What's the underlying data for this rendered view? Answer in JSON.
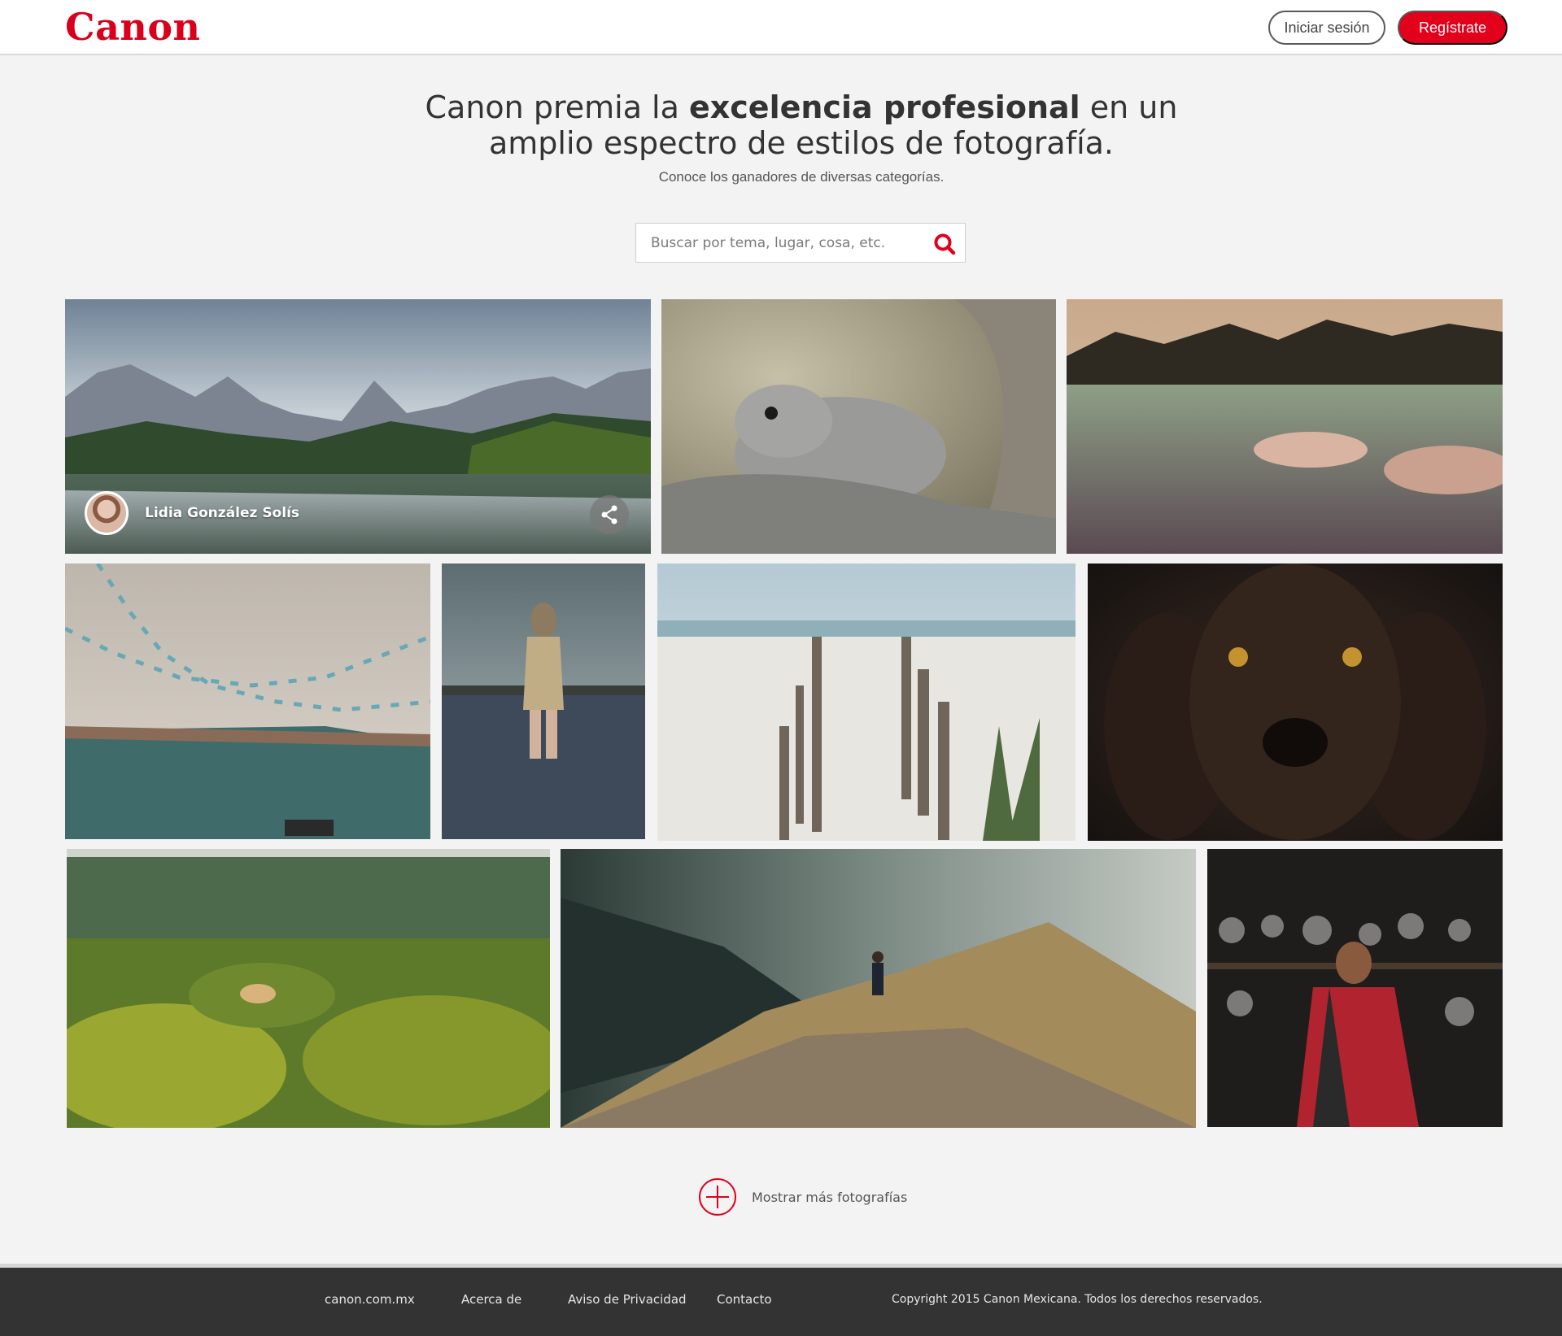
{
  "header": {
    "logo": "Canon",
    "login_label": "Iniciar sesión",
    "register_label": "Regístrate"
  },
  "hero": {
    "title_pre": "Canon premia la ",
    "title_bold": "excelencia profesional",
    "title_post": " en un amplio espectro de estilos de fotografía.",
    "subtitle": "Conoce los ganadores de diversas categorías."
  },
  "search": {
    "placeholder": "Buscar por tema, lugar, cosa, etc."
  },
  "featured_credit": {
    "name": "Lidia González Solís"
  },
  "gallery": {
    "photos": [
      {
        "subject": "mountain lake landscape"
      },
      {
        "subject": "squirrel on rock"
      },
      {
        "subject": "woman floating in water"
      },
      {
        "subject": "flag bunting over building"
      },
      {
        "subject": "woman standing in lake"
      },
      {
        "subject": "beach with wooden posts"
      },
      {
        "subject": "dark dog portrait"
      },
      {
        "subject": "vineyard worker"
      },
      {
        "subject": "hiker on misty mountain ridge"
      },
      {
        "subject": "woman in kitchen with pots"
      }
    ]
  },
  "load_more": {
    "label": "Mostrar más fotografías"
  },
  "footer": {
    "links": [
      "canon.com.mx",
      "Acerca de",
      "Aviso de Privacidad",
      "Contacto"
    ],
    "copyright": "Copyright 2015 Canon Mexicana. Todos los derechos reservados."
  },
  "colors": {
    "brand_red": "#e3001b",
    "footer_bg": "#333333",
    "page_bg": "#f3f3f3"
  }
}
